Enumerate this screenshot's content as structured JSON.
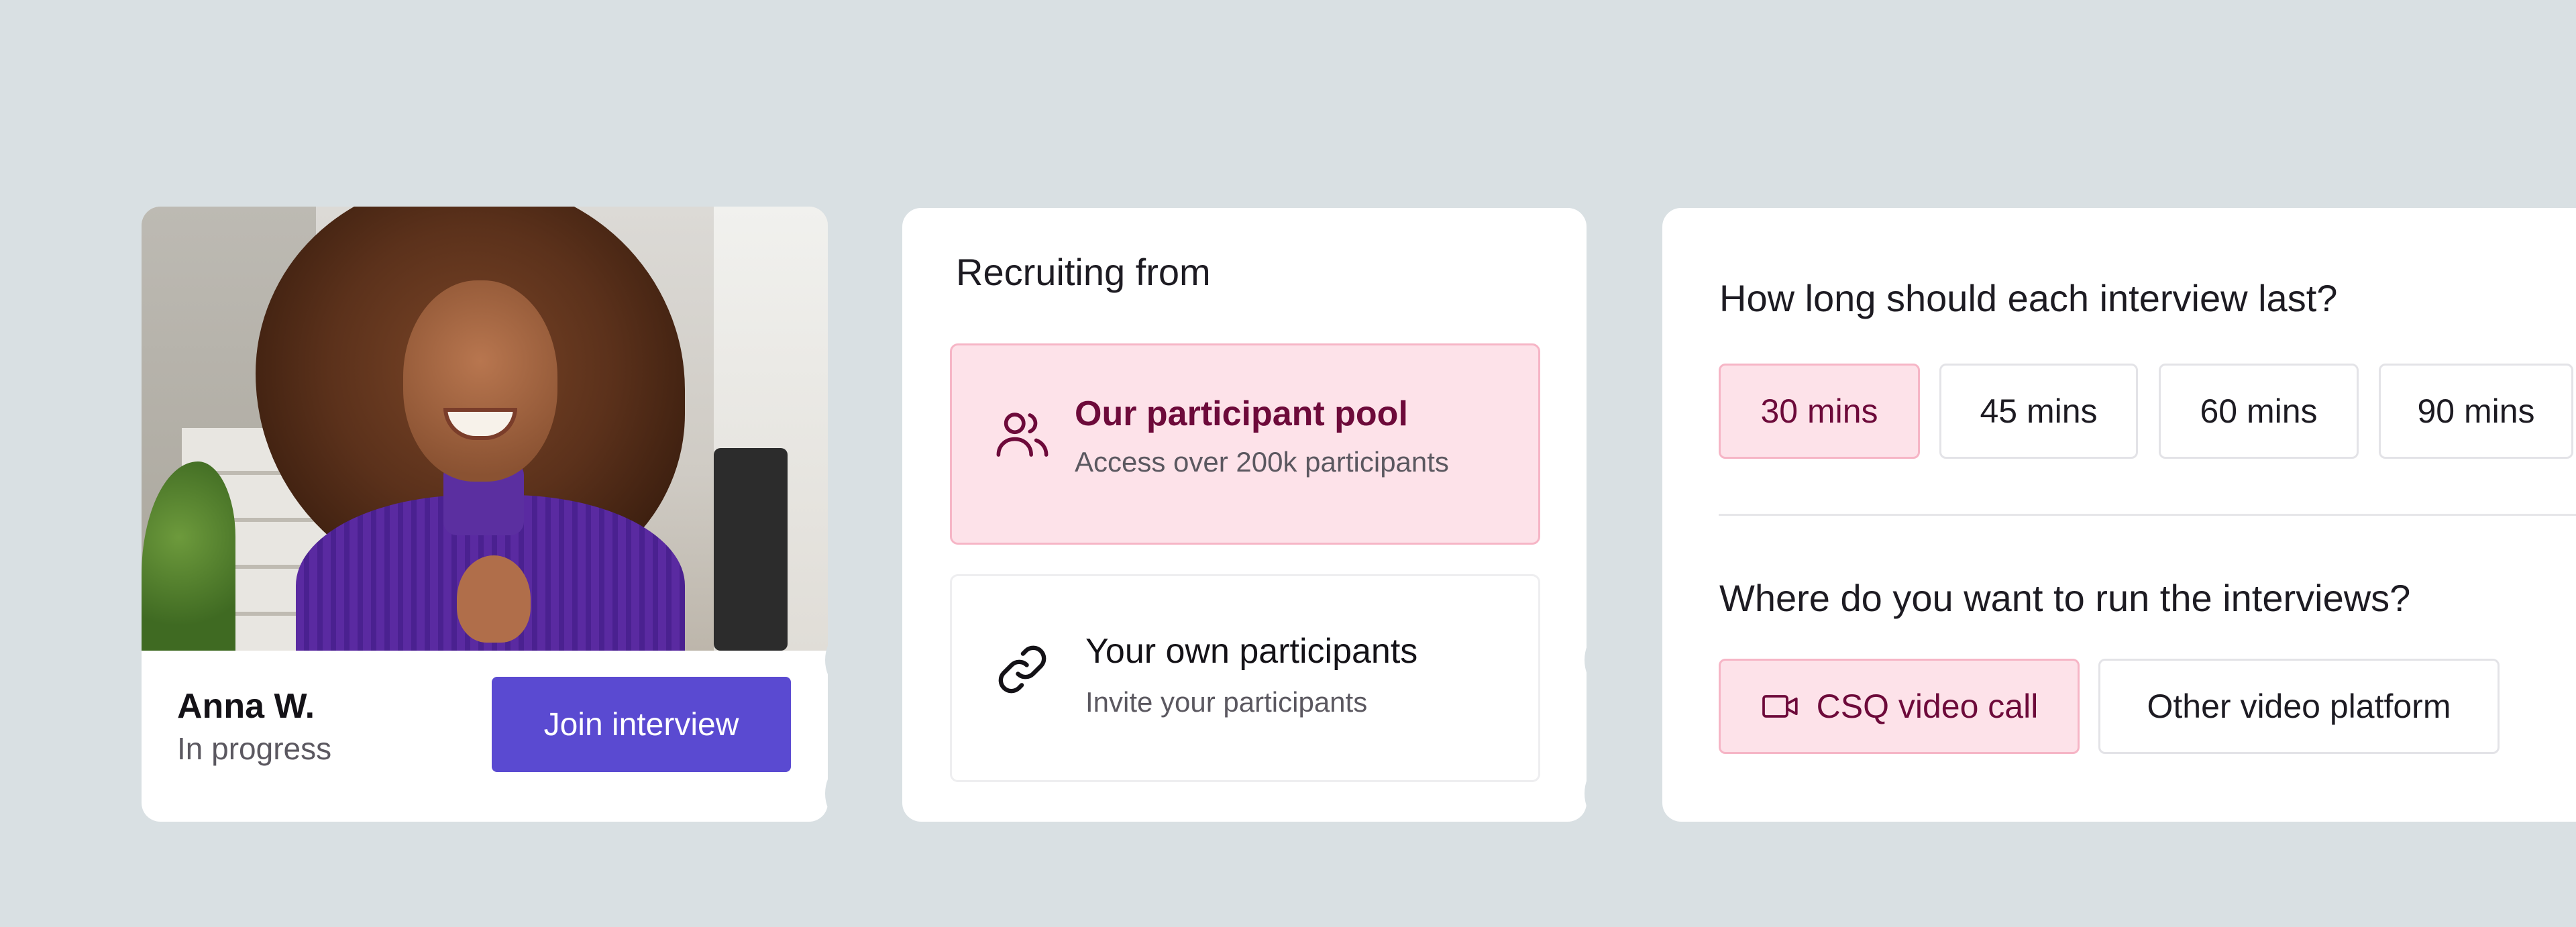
{
  "participant": {
    "name": "Anna W.",
    "status": "In progress",
    "join_label": "Join interview"
  },
  "recruiting": {
    "title": "Recruiting from",
    "options": [
      {
        "title": "Our participant pool",
        "subtitle": "Access over 200k participants",
        "icon": "users-icon",
        "selected": true
      },
      {
        "title": "Your own participants",
        "subtitle": "Invite your participants",
        "icon": "link-icon",
        "selected": false
      }
    ]
  },
  "settings": {
    "duration_question": "How long should each interview last?",
    "durations": [
      "30 mins",
      "45 mins",
      "60 mins",
      "90 mins"
    ],
    "selected_duration": "30 mins",
    "location_question": "Where do you want to run the interviews?",
    "locations": [
      {
        "label": "CSQ video call",
        "icon": "video-camera-icon",
        "selected": true
      },
      {
        "label": "Other video platform",
        "selected": false
      }
    ]
  },
  "colors": {
    "background": "#d9e0e3",
    "accent": "#5a4ad1",
    "selected_fill": "#fde2e9",
    "selected_border": "#f6b5c6",
    "selected_text": "#6d0a3a"
  }
}
